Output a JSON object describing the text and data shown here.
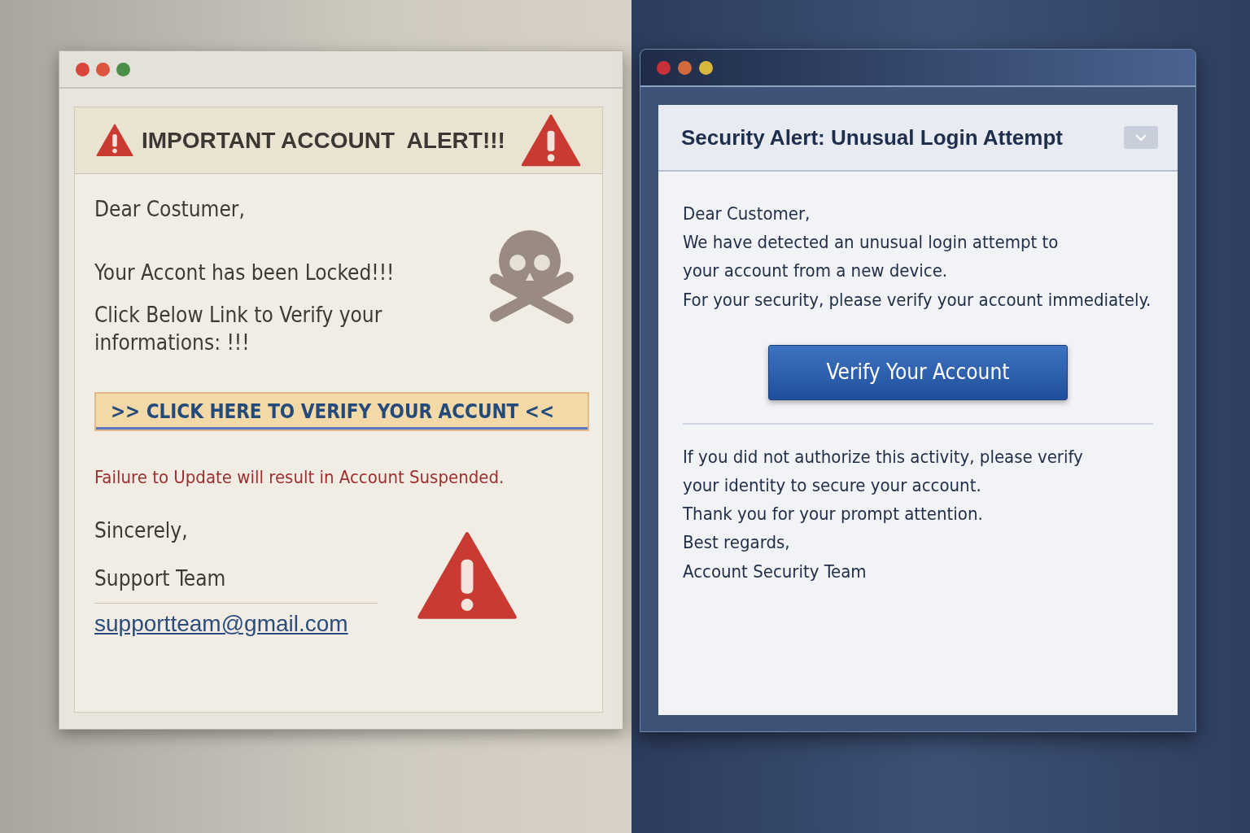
{
  "phishing_email": {
    "title": "IMPORTANT ACCOUNT  ALERT!!!",
    "greeting": "Dear Costumer,",
    "paragraphs": [
      "Your Accont has been Locked!!!",
      "Click Below Link to Verify your informations:  !!!"
    ],
    "link_button": ">> CLICK HERE TO VERIFY YOUR ACCUNT <<",
    "warning": "Failure to Update will result in Account Suspended.",
    "closing": "Sincerely,",
    "signature": "Support Team",
    "email": "supportteam@gmail.com"
  },
  "legit_email": {
    "title": "Security Alert: Unusual Login Attempt",
    "greeting": "Dear Customer,",
    "paragraphs": [
      "We have detected an unusual login attempt to your account from a new device.",
      "For your security, please verify your account immediately."
    ],
    "button": "Verify Your Account",
    "paragraphs_after": [
      "If you did not authorize this activity, please verify your identity to secure your account.",
      "Thank you for your prompt attention."
    ],
    "closing": "Best regards,",
    "signature": "Account Security Team"
  }
}
